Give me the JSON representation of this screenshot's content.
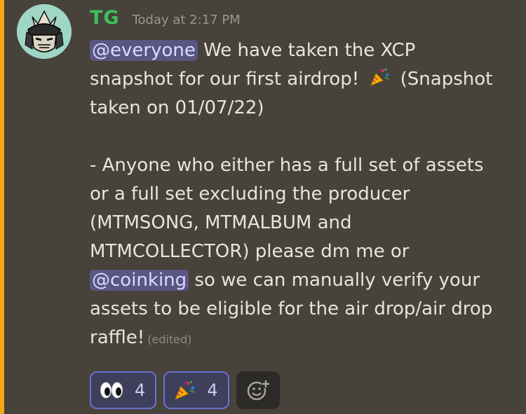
{
  "message": {
    "author": "TG",
    "timestamp": "Today at 2:17 PM",
    "lines": [
      {
        "mention": "@everyone",
        "text": " We have taken the XCP"
      },
      {
        "pre": "snapshot for our first airdrop!",
        "emoji": "party-popper",
        "post": "(Snapshot"
      },
      {
        "text": "taken on 01/07/22)"
      },
      {
        "text": "- Anyone who either has a full set of assets"
      },
      {
        "text": "or a full set excluding the producer"
      },
      {
        "text": "(MTMSONG, MTMALBUM and"
      },
      {
        "text": "MTMCOLLECTOR) please dm me or"
      },
      {
        "mention": "@coinking",
        "text": " so we can manually verify your"
      },
      {
        "text": "assets to be eligible for the air drop/air drop"
      },
      {
        "text": "raffle!",
        "edited": "(edited)"
      }
    ]
  },
  "reactions": [
    {
      "emoji": "eyes",
      "count": "4"
    },
    {
      "emoji": "party-popper",
      "count": "4"
    }
  ],
  "colors": {
    "accent": "#f3a814",
    "username": "#3fc05a",
    "mention_bg": "#5a5582",
    "reaction_border": "#6c70d6"
  }
}
